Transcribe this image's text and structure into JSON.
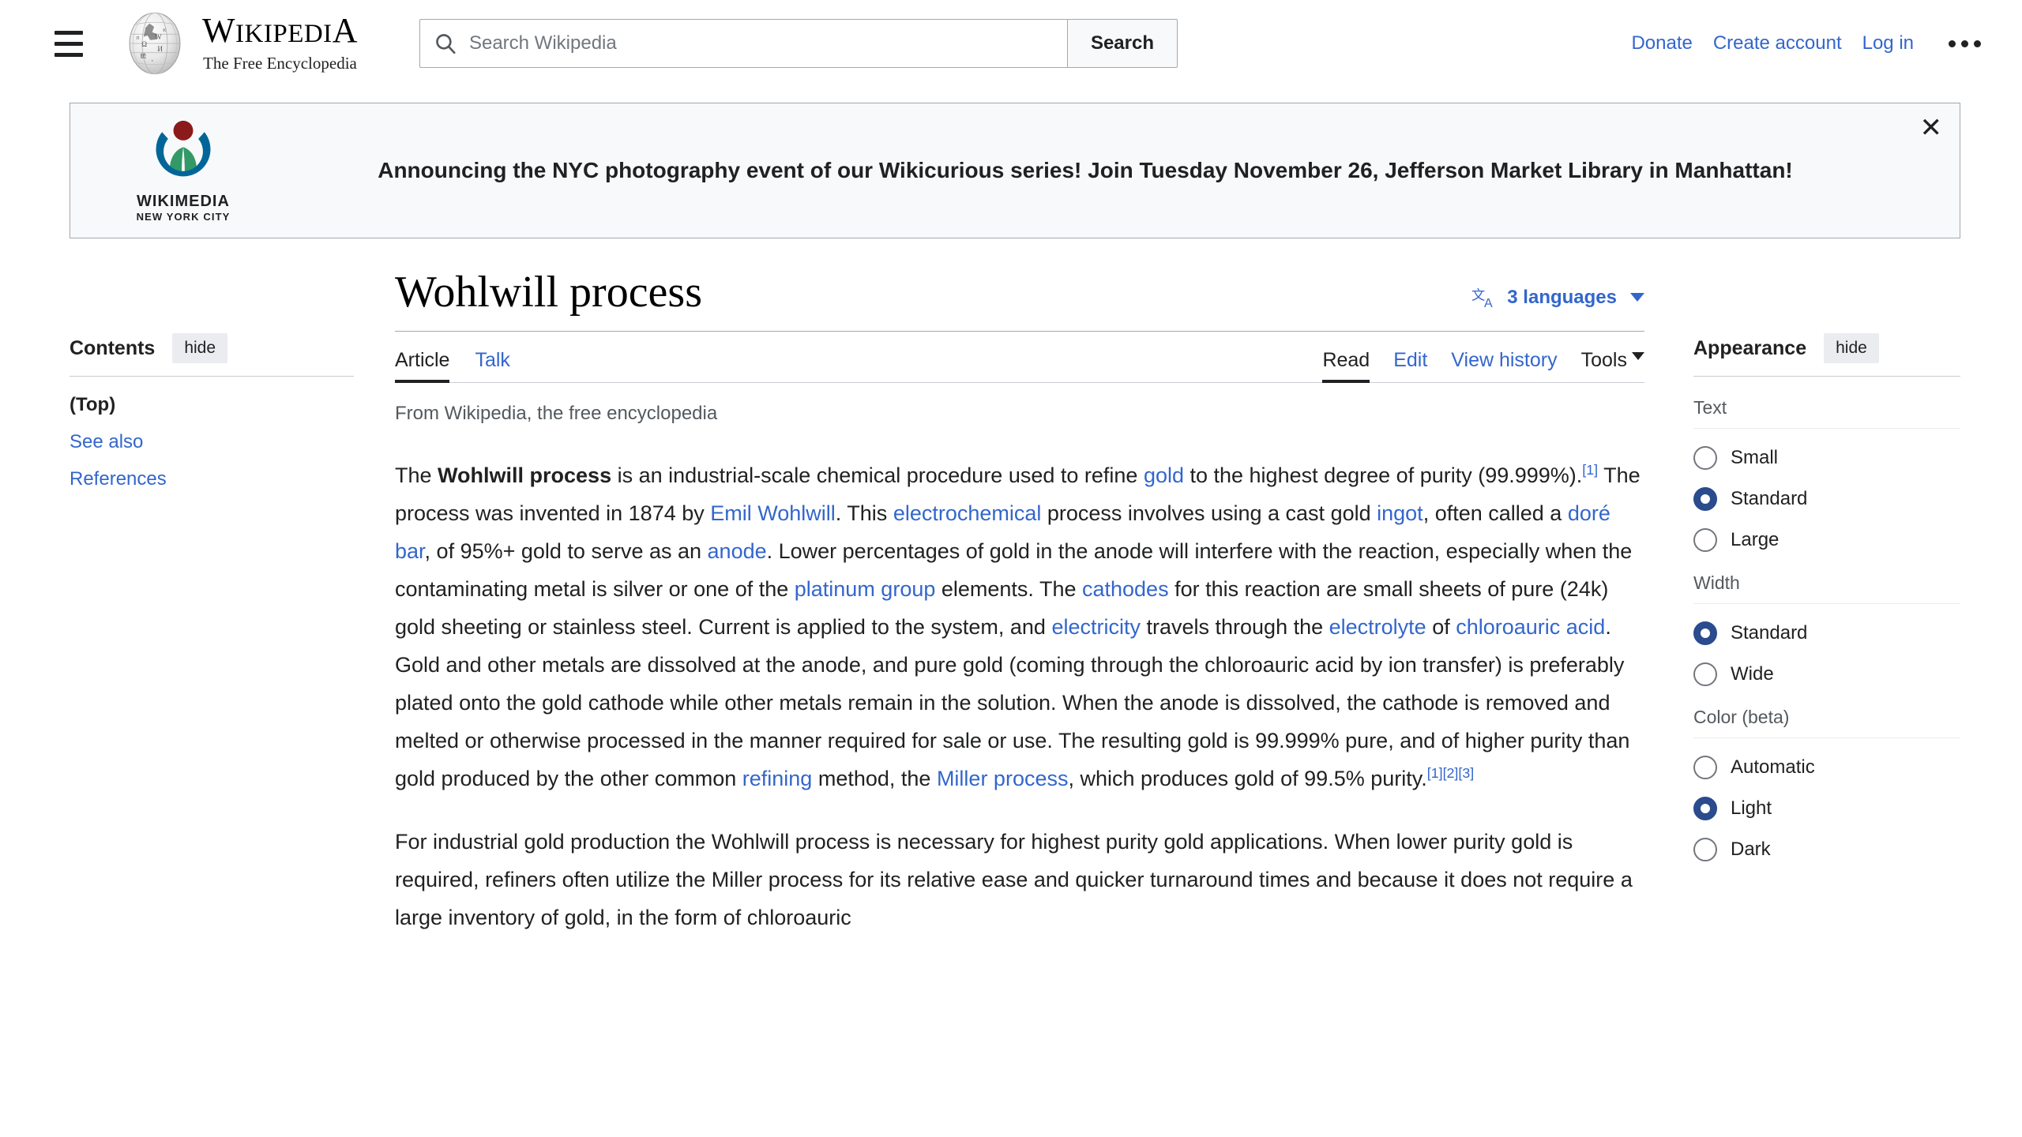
{
  "header": {
    "menu_icon": "hamburger-icon",
    "logo_name_major": "W",
    "wordmark_parts": [
      "W",
      "IKIPEDI",
      "A"
    ],
    "wordmark_text": "WIKIPEDIA",
    "tagline": "The Free Encyclopedia",
    "search": {
      "placeholder": "Search Wikipedia",
      "value": "",
      "button_label": "Search",
      "icon": "search-icon"
    },
    "links": [
      {
        "label": "Donate"
      },
      {
        "label": "Create account"
      },
      {
        "label": "Log in"
      }
    ],
    "more_icon": "ellipsis-icon"
  },
  "banner": {
    "logo_name": "WIKIMEDIA",
    "logo_sub": "NEW YORK CITY",
    "message": "Announcing the NYC photography event of our Wikicurious series! Join Tuesday November 26, Jefferson Market Library in Manhattan!",
    "close_icon": "close-icon",
    "close_label": "✕"
  },
  "contents": {
    "heading": "Contents",
    "hide_label": "hide",
    "items": [
      {
        "label": "(Top)",
        "current": true
      },
      {
        "label": "See also",
        "current": false
      },
      {
        "label": "References",
        "current": false
      }
    ]
  },
  "article": {
    "title": "Wohlwill process",
    "languages": {
      "icon": "language-icon",
      "label": "3 languages",
      "chevron": "chevron-down-icon"
    },
    "namespace_tabs": [
      {
        "label": "Article",
        "selected": true
      },
      {
        "label": "Talk",
        "selected": false
      }
    ],
    "view_tabs": [
      {
        "label": "Read",
        "selected": true
      },
      {
        "label": "Edit",
        "selected": false
      },
      {
        "label": "View history",
        "selected": false
      }
    ],
    "tools_label": "Tools",
    "tagline": "From Wikipedia, the free encyclopedia",
    "paragraph1": {
      "t1": "The ",
      "bold": "Wohlwill process",
      "t2": " is an industrial-scale chemical procedure used to refine ",
      "l1": "gold",
      "t3": " to the highest degree of purity (99.999%).",
      "r1": "[1]",
      "t4": " The process was invented in 1874 by ",
      "l2": "Emil Wohlwill",
      "t5": ". This ",
      "l3": "electrochemical",
      "t6": " process involves using a cast gold ",
      "l4": "ingot",
      "t7": ", often called a ",
      "l5": "doré bar",
      "t8": ", of 95%+ gold to serve as an ",
      "l6": "anode",
      "t9": ". Lower percentages of gold in the anode will interfere with the reaction, especially when the contaminating metal is silver or one of the ",
      "l7": "platinum group",
      "t10": " elements. The ",
      "l8": "cathodes",
      "t11": " for this reaction are small sheets of pure (24k) gold sheeting or stainless steel. Current is applied to the system, and ",
      "l9": "electricity",
      "t12": " travels through the ",
      "l10": "electrolyte",
      "t13": " of ",
      "l11": "chloroauric acid",
      "t14": ". Gold and other metals are dissolved at the anode, and pure gold (coming through the chloroauric acid by ion transfer) is preferably plated onto the gold cathode while other metals remain in the solution. When the anode is dissolved, the cathode is removed and melted or otherwise processed in the manner required for sale or use. The resulting gold is 99.999% pure, and of higher purity than gold produced by the other common ",
      "l12": "refining",
      "t15": " method, the ",
      "l13": "Miller process",
      "t16": ", which produces gold of 99.5% purity.",
      "r2": "[1]",
      "r3": "[2]",
      "r4": "[3]"
    },
    "paragraph2": "For industrial gold production the Wohlwill process is necessary for highest purity gold applications. When lower purity gold is required, refiners often utilize the Miller process for its relative ease and quicker turnaround times and because it does not require a large inventory of gold, in the form of chloroauric"
  },
  "appearance": {
    "heading": "Appearance",
    "hide_label": "hide",
    "groups": [
      {
        "label": "Text",
        "options": [
          {
            "label": "Small",
            "selected": false
          },
          {
            "label": "Standard",
            "selected": true
          },
          {
            "label": "Large",
            "selected": false
          }
        ]
      },
      {
        "label": "Width",
        "options": [
          {
            "label": "Standard",
            "selected": true
          },
          {
            "label": "Wide",
            "selected": false
          }
        ]
      },
      {
        "label": "Color (beta)",
        "options": [
          {
            "label": "Automatic",
            "selected": false
          },
          {
            "label": "Light",
            "selected": true
          },
          {
            "label": "Dark",
            "selected": false
          }
        ]
      }
    ]
  },
  "colors": {
    "link": "#3366cc",
    "text": "#202122",
    "radio_on": "#2a4b8d",
    "banner_bg": "#f8f9fa",
    "border": "#a2a9b1"
  }
}
